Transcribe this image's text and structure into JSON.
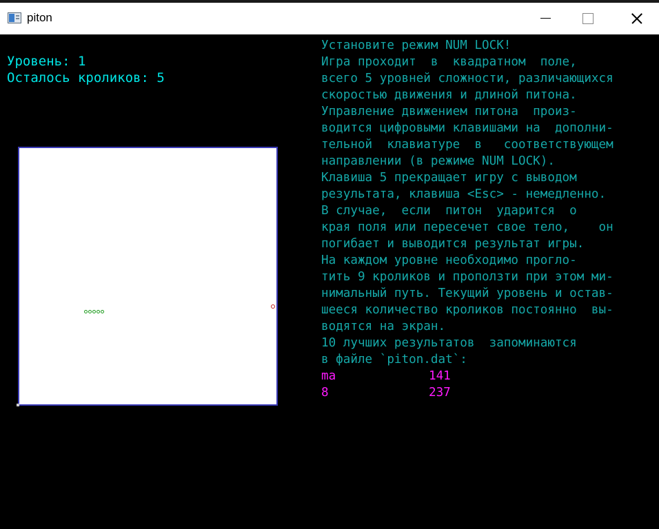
{
  "window": {
    "title": "piton",
    "icon": "console-app-icon",
    "buttons": [
      "minimize",
      "maximize",
      "close"
    ]
  },
  "status": {
    "level_line": "Уровень: 1",
    "rabbits_line": "Осталось кроликов: 5"
  },
  "help_lines": [
    "Установите режим NUM LOCK!",
    "Игра проходит  в  квадратном  поле,",
    "всего 5 уровней сложности, различающихся",
    "скоростью движения и длиной питона.",
    "Управление движением питона  произ-",
    "водится цифровыми клавишами на  дополни-",
    "тельной  клавиатуре  в   соответствующем",
    "направлении (в режиме NUM LOCK).",
    "Клавиша 5 прекращает игру с выводом",
    "результата, клавиша <Esc> - немедленно.",
    "В случае,  если  питон  ударится  о",
    "края поля или пересечет свое тело,    он",
    "погибает и выводится результат игры.",
    "На каждом уровне необходимо прогло-",
    "тить 9 кроликов и проползти при этом ми-",
    "нимальный путь. Текущий уровень и остав-",
    "шееся количество кроликов постоянно  вы-",
    "водятся на экран.",
    "10 лучших результатов  запоминаются",
    "в файле `piton.dat`:"
  ],
  "scores": [
    {
      "name": "ma",
      "value": "141"
    },
    {
      "name": "8",
      "value": "237"
    }
  ],
  "colors": {
    "background": "#000000",
    "status_text": "#00e6e6",
    "help_text": "#15a8a8",
    "scores_text": "#ff1aff",
    "field": "#ffffff",
    "field_border": "#3b3bb8",
    "snake": "#1a9a1a",
    "rabbit": "#c02020"
  },
  "game": {
    "snake_length": 5
  }
}
